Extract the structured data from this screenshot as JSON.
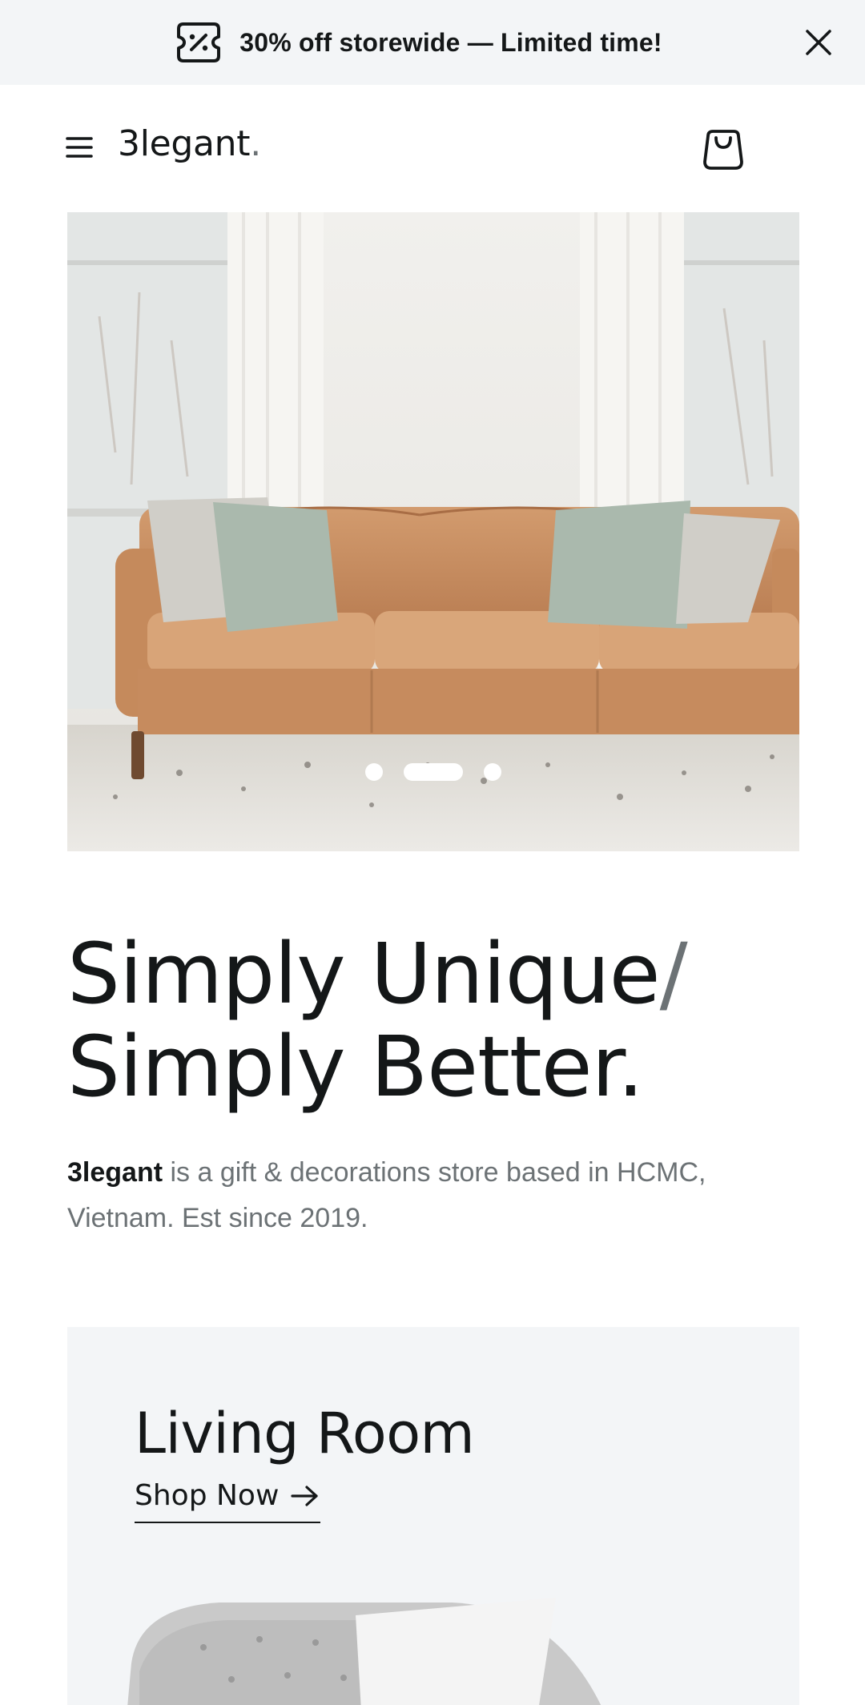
{
  "promo": {
    "icon": "ticket-percent-icon",
    "text": "30% off storewide — Limited time!",
    "close_icon": "close-icon"
  },
  "nav": {
    "menu_icon": "hamburger-icon",
    "logo": "3legant",
    "logo_dot": ".",
    "cart_icon": "shopping-bag-icon"
  },
  "hero": {
    "image": "leather-sofa-photo",
    "slides_total": 3,
    "active_slide": 2
  },
  "headline": {
    "line1": "Simply Unique",
    "slash": "/",
    "line2": "Simply Better."
  },
  "tagline": {
    "brand": "3legant",
    "text": " is a gift & decorations store based in HCMC, Vietnam. Est since 2019."
  },
  "category": {
    "title": "Living Room",
    "link_label": "Shop Now",
    "link_icon": "arrow-right-icon",
    "image": "armchair-photo"
  },
  "colors": {
    "text": "#141718",
    "muted": "#6c7275",
    "surface": "#f3f5f7"
  }
}
